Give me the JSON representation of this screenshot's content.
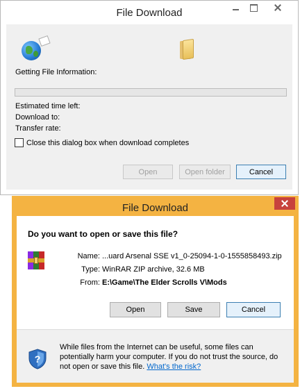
{
  "dialog_progress": {
    "title": "File Download",
    "status": "Getting File Information:",
    "estimated_time_label": "Estimated time left:",
    "download_to_label": "Download to:",
    "transfer_rate_label": "Transfer rate:",
    "close_when_done_label": "Close this dialog box when download completes",
    "close_when_done_checked": false,
    "progress_percent": 0,
    "buttons": {
      "open": "Open",
      "open_folder": "Open folder",
      "cancel": "Cancel"
    }
  },
  "dialog_save": {
    "title": "File Download",
    "question": "Do you want to open or save this file?",
    "name_label": "Name:",
    "name_value": "...uard Arsenal SSE v1_0-25094-1-0-1555858493.zip",
    "type_label": "Type:",
    "type_value": "WinRAR ZIP archive, 32.6 MB",
    "from_label": "From:",
    "from_value": "E:\\Game\\The Elder Scrolls V\\Mods",
    "buttons": {
      "open": "Open",
      "save": "Save",
      "cancel": "Cancel"
    },
    "warning_text": "While files from the Internet can be useful, some files can potentially harm your computer. If you do not trust the source, do not open or save this file.",
    "warning_link": "What's the risk?"
  },
  "icons": {
    "globe": "globe-icon",
    "folder": "folder-icon",
    "archive": "winrar-archive-icon",
    "shield": "security-shield-icon"
  },
  "colors": {
    "accent_frame": "#f4b342",
    "close_red": "#c7423d",
    "link_blue": "#0066cc"
  }
}
